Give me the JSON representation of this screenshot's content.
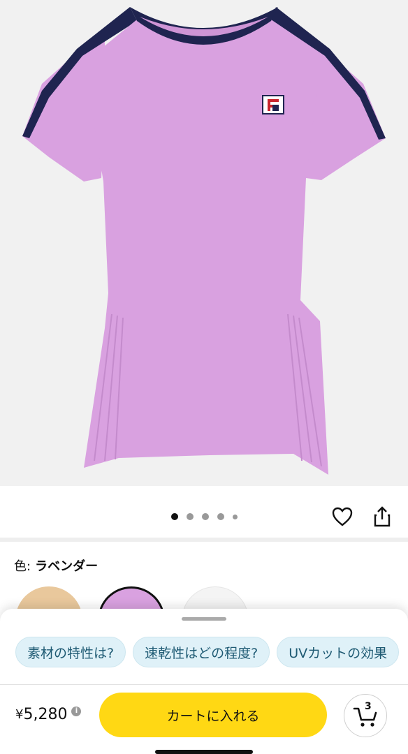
{
  "product": {
    "image_alt": "shirt-illustration",
    "colors": {
      "body": "#d9a1e0",
      "trim": "#1f2450",
      "background": "#f1f1f1"
    }
  },
  "carousel": {
    "dots": 5,
    "active_index": 0
  },
  "color_select": {
    "label": "色:",
    "value": "ラベンダー"
  },
  "swatches": [
    "beige",
    "lavender",
    "white"
  ],
  "suggestions": [
    "素材の特性は?",
    "速乾性はどの程度?",
    "UVカットの効果"
  ],
  "purchase": {
    "price": "5,280",
    "currency": "¥",
    "info": "i",
    "cart_button": "カートに入れる",
    "cart_count": "3"
  }
}
